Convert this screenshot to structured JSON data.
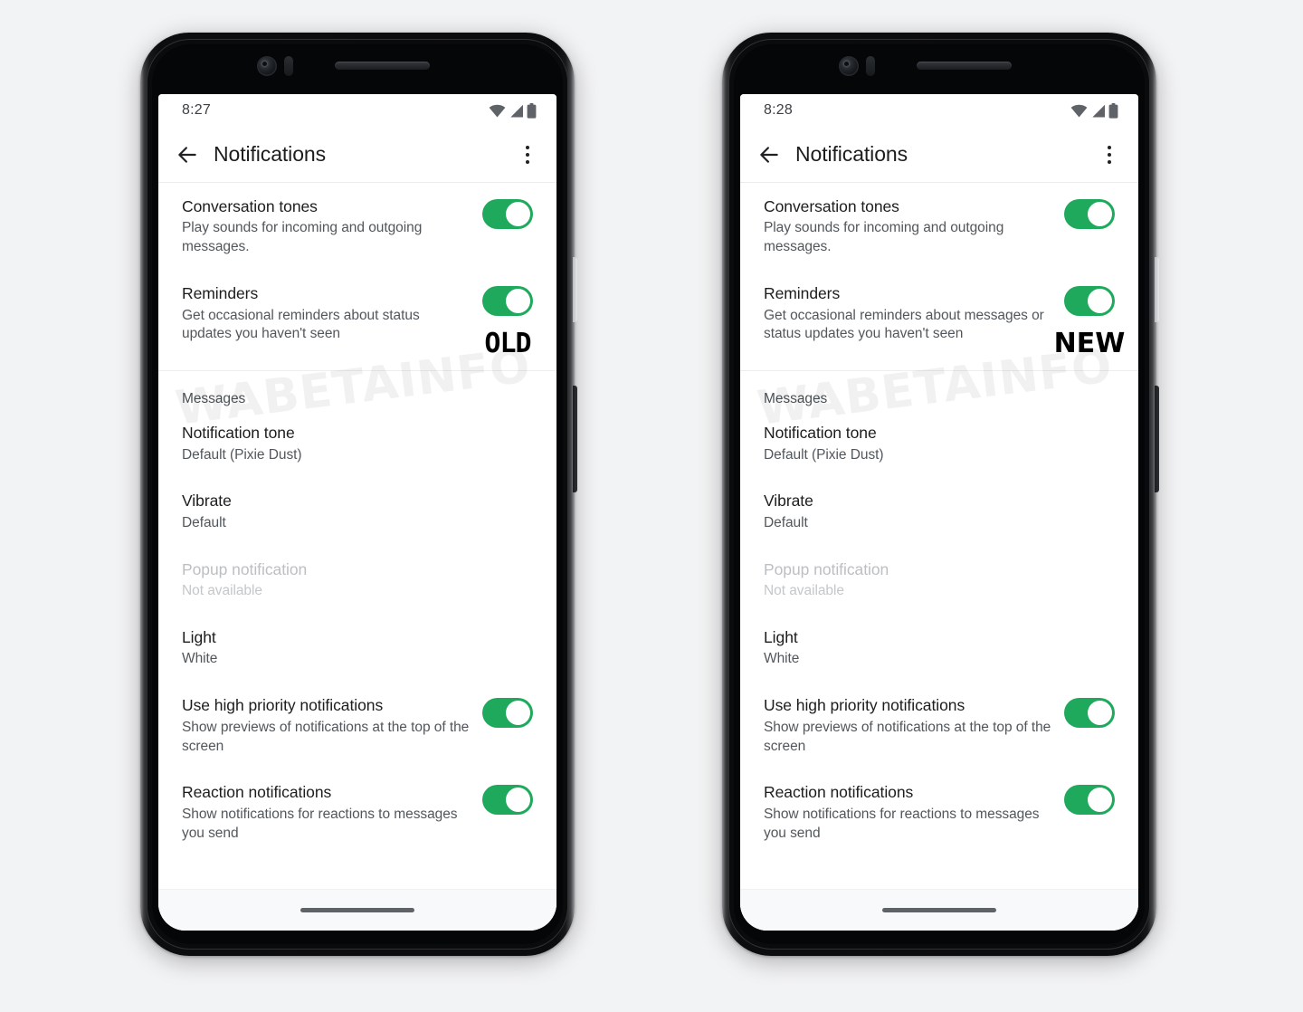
{
  "background_color": "#f2f3f4",
  "accent_green": "#1fa95c",
  "watermark": "WABETAINFO",
  "phones": [
    {
      "variant": "old",
      "badge": "OLD",
      "status": {
        "time": "8:27",
        "wifi_icon": "wifi-icon",
        "signal_icon": "signal-icon",
        "battery_icon": "battery-icon"
      },
      "appbar": {
        "back_icon": "back-arrow-icon",
        "title": "Notifications",
        "overflow_icon": "overflow-menu-icon"
      },
      "rows": [
        {
          "name": "conversation-tones",
          "title": "Conversation tones",
          "subtitle": "Play sounds for incoming and outgoing messages.",
          "toggle": true,
          "toggle_on": true,
          "disabled": false
        },
        {
          "name": "reminders",
          "title": "Reminders",
          "subtitle": "Get occasional reminders about status updates you haven't seen",
          "toggle": true,
          "toggle_on": true,
          "disabled": false
        }
      ],
      "section_label": "Messages",
      "rows2": [
        {
          "name": "notification-tone",
          "title": "Notification tone",
          "subtitle": "Default (Pixie Dust)",
          "toggle": false,
          "disabled": false
        },
        {
          "name": "vibrate",
          "title": "Vibrate",
          "subtitle": "Default",
          "toggle": false,
          "disabled": false
        },
        {
          "name": "popup-notification",
          "title": "Popup notification",
          "subtitle": "Not available",
          "toggle": false,
          "disabled": true
        },
        {
          "name": "light",
          "title": "Light",
          "subtitle": "White",
          "toggle": false,
          "disabled": false
        },
        {
          "name": "high-priority-notifications",
          "title": "Use high priority notifications",
          "subtitle": "Show previews of notifications at the top of the screen",
          "toggle": true,
          "toggle_on": true,
          "disabled": false
        },
        {
          "name": "reaction-notifications",
          "title": "Reaction notifications",
          "subtitle": "Show notifications for reactions to messages you send",
          "toggle": true,
          "toggle_on": true,
          "disabled": false
        }
      ]
    },
    {
      "variant": "new",
      "badge": "NEW",
      "status": {
        "time": "8:28",
        "wifi_icon": "wifi-icon",
        "signal_icon": "signal-icon",
        "battery_icon": "battery-icon"
      },
      "appbar": {
        "back_icon": "back-arrow-icon",
        "title": "Notifications",
        "overflow_icon": "overflow-menu-icon"
      },
      "rows": [
        {
          "name": "conversation-tones",
          "title": "Conversation tones",
          "subtitle": "Play sounds for incoming and outgoing messages.",
          "toggle": true,
          "toggle_on": true,
          "disabled": false
        },
        {
          "name": "reminders",
          "title": "Reminders",
          "subtitle": "Get occasional reminders about messages or status updates you haven't seen",
          "toggle": true,
          "toggle_on": true,
          "disabled": false
        }
      ],
      "section_label": "Messages",
      "rows2": [
        {
          "name": "notification-tone",
          "title": "Notification tone",
          "subtitle": "Default (Pixie Dust)",
          "toggle": false,
          "disabled": false
        },
        {
          "name": "vibrate",
          "title": "Vibrate",
          "subtitle": "Default",
          "toggle": false,
          "disabled": false
        },
        {
          "name": "popup-notification",
          "title": "Popup notification",
          "subtitle": "Not available",
          "toggle": false,
          "disabled": true
        },
        {
          "name": "light",
          "title": "Light",
          "subtitle": "White",
          "toggle": false,
          "disabled": false
        },
        {
          "name": "high-priority-notifications",
          "title": "Use high priority notifications",
          "subtitle": "Show previews of notifications at the top of the screen",
          "toggle": true,
          "toggle_on": true,
          "disabled": false
        },
        {
          "name": "reaction-notifications",
          "title": "Reaction notifications",
          "subtitle": "Show notifications for reactions to messages you send",
          "toggle": true,
          "toggle_on": true,
          "disabled": false
        }
      ]
    }
  ]
}
